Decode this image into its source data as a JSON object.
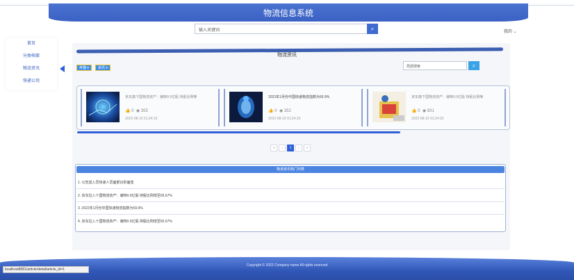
{
  "header": {
    "site_title": "物流信息系统",
    "search_placeholder": "输入关键词",
    "user_menu": "我的 ⌄"
  },
  "sidebar": {
    "items": [
      {
        "label": "首页"
      },
      {
        "label": "分类档案"
      },
      {
        "label": "物流资讯"
      },
      {
        "label": "快递公司"
      }
    ],
    "active_index": 2
  },
  "section": {
    "title": "物流资讯",
    "filters": [
      "养猫 ▾",
      "资讯 ▾"
    ],
    "search_placeholder": "局部搜索"
  },
  "cards": [
    {
      "title": "京东旗下国物流资产：瀚特9.9亿股 持股比例等",
      "likes": "0",
      "views": "355",
      "date": "2022-08-10 01:24:10",
      "thumb_icon": "tech-blue-image"
    },
    {
      "title": "2022年1月份中国快递物流指数为59.9%",
      "likes": "0",
      "views": "352",
      "date": "2022-08-10 01:24:10",
      "thumb_icon": "body-scan-image"
    },
    {
      "title": "京东旗下国物流资产：瀚特9.9亿股 持股比例等",
      "likes": "0",
      "views": "831",
      "date": "2022-08-10 01:24:10",
      "thumb_icon": "worker-illustration-image"
    }
  ],
  "pagination": {
    "prev2": "«",
    "prev": "‹",
    "current": "1",
    "next": "›",
    "next2": "»"
  },
  "hot_list": {
    "title": "物流资讯热门列表",
    "rows": [
      "1. 公告送入员快递人员面部识别面签",
      "2. 京东拉入十国物流资产：瀚特9.9亿股 持股比例增至65.67%",
      "3. 2022年1月份中国快递物流指数为59.9%",
      "4. 京东拉入十国物流资产：瀚特9.9亿股 持股比例增至65.67%"
    ]
  },
  "footer": {
    "copyright": "Copyright © 2022 Company name All rights reserved",
    "status_url": "localhost8081/article/detail/article_id=1"
  },
  "colors": {
    "primary": "#2f5fd6",
    "header": "#4a72d0",
    "accent_border": "#f1c42d"
  }
}
